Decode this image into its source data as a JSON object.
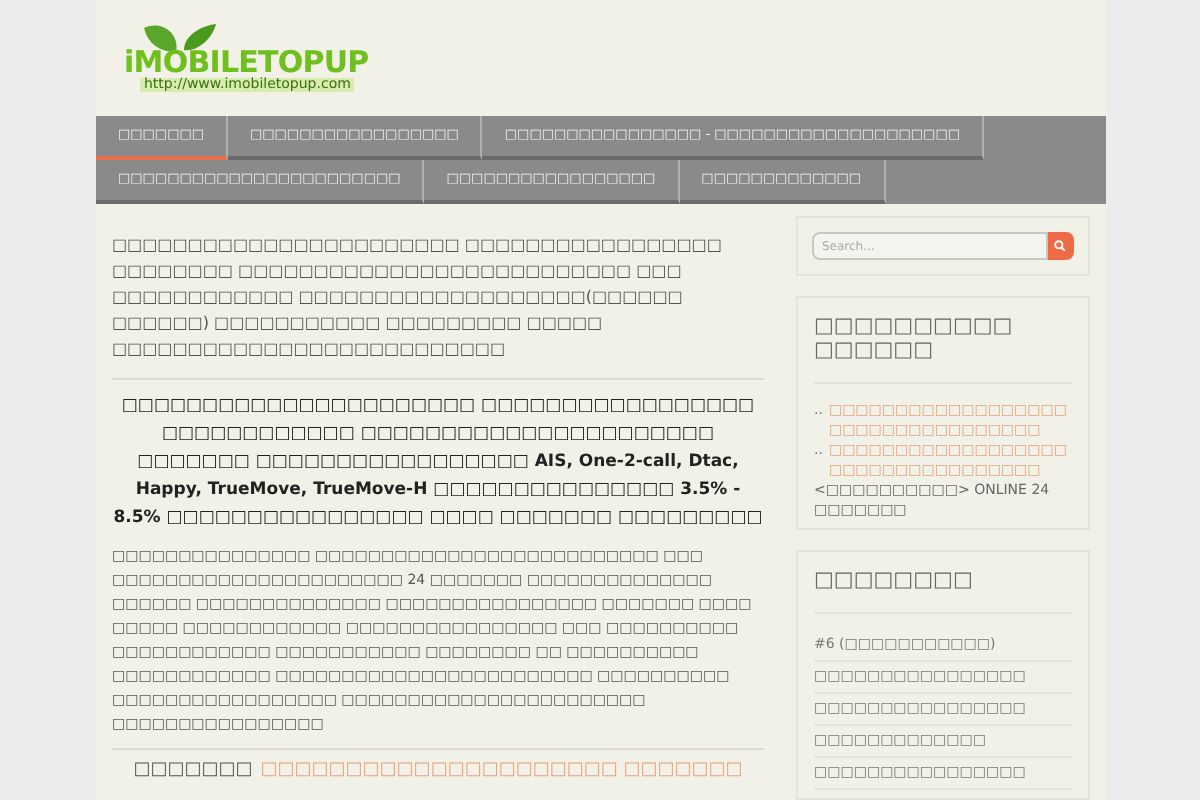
{
  "logo": {
    "name": "iMOBILETOPUP",
    "url": "http://www.imobiletopup.com"
  },
  "nav": {
    "items": [
      {
        "label": "□□□□□□□",
        "selected": true
      },
      {
        "label": "□□□□□□□□□□□□□□□□□",
        "selected": false
      },
      {
        "label": "□□□□□□□□□□□□□□□□ - □□□□□□□□□□□□□□□□□□□□",
        "selected": false
      },
      {
        "label": "□□□□□□□□□□□□□□□□□□□□□□□",
        "selected": false
      },
      {
        "label": "□□□□□□□□□□□□□□□□□",
        "selected": false
      },
      {
        "label": "□□□□□□□□□□□□□",
        "selected": false
      }
    ]
  },
  "article": {
    "intro": "□□□□□□□□□□□□□□□□□□□□□□□ □□□□□□□□□□□□□□□□□ □□□□□□□□ □□□□□□□□□□□□□□□□□□□□□□□□□□ □□□ □□□□□□□□□□□□ □□□□□□□□□□□□□□□□□□□(□□□□□□ □□□□□□) □□□□□□□□□□□ □□□□□□□□□ □□□□□ □□□□□□□□□□□□□□□□□□□□□□□□□□",
    "heading": "□□□□□□□□□□□□□□□□□□□□□□ □□□□□□□□□□□□□□□□□ □□□□□□□□□□□□ □□□□□□□□□□□□□□□□□□□□□□ □□□□□□□ □□□□□□□□□□□□□□□□□ **AIS, One-2-call, Dtac, Happy, TrueMove, TrueMove-H** □□□□□□□□□□□□□□□ **3.5% - 8.5%** □□□□□□□□□□□□□□□□ □□□□ □□□□□□□ □□□□□□□□□",
    "body": "□□□□□□□□□□□□□□□ □□□□□□□□□□□□□□□□□□□□□□□□□□ □□□ □□□□□□□□□□□□□□□□□□□□□□ 24 □□□□□□□ □□□□□□□□□□□□□□ □□□□□□ □□□□□□□□□□□□□□ □□□□□□□□□□□□□□□□ □□□□□□□ □□□□ □□□□□ □□□□□□□□□□□□ □□□□□□□□□□□□□□□□ □□□ □□□□□□□□□□ □□□□□□□□□□□□ □□□□□□□□□□□ □□□□□□□□ □□ □□□□□□□□□□ □□□□□□□□□□□□ □□□□□□□□□□□□□□□□□□□□□□□□ □□□□□□□□□□ □□□□□□□□□□□□□□□□□ □□□□□□□□□□□□□□□□□□□□□□□ □□□□□□□□□□□□□□□□",
    "footer_text": "□□□□□□□",
    "footer_link": "□□□□□□□□□□□□□□□□□□□□□ □□□□□□□"
  },
  "sidebar": {
    "search": {
      "placeholder": "Search..."
    },
    "widgets": [
      {
        "title": "□□□□□□□□□□ □□□□□□",
        "items": [
          {
            "kind": "link",
            "prefix": "..",
            "text": "□□□□□□□□□□□□□□□□□□ □□□□□□□□□□□□□□□□"
          },
          {
            "kind": "link",
            "prefix": "..",
            "text": "□□□□□□□□□□□□□□□□□□ □□□□□□□□□□□□□□□□"
          },
          {
            "kind": "plain",
            "text": "<□□□□□□□□□□> ONLINE 24 □□□□□□□"
          }
        ]
      },
      {
        "title": "□□□□□□□□",
        "items": [
          {
            "kind": "row",
            "text": "#6 (□□□□□□□□□□□)"
          },
          {
            "kind": "row",
            "text": "□□□□□□□□□□□□□□□□"
          },
          {
            "kind": "row",
            "text": "□□□□□□□□□□□□□□□□"
          },
          {
            "kind": "row",
            "text": "□□□□□□□□□□□□□"
          },
          {
            "kind": "row",
            "text": "□□□□□□□□□□□□□□□□"
          }
        ]
      }
    ]
  }
}
